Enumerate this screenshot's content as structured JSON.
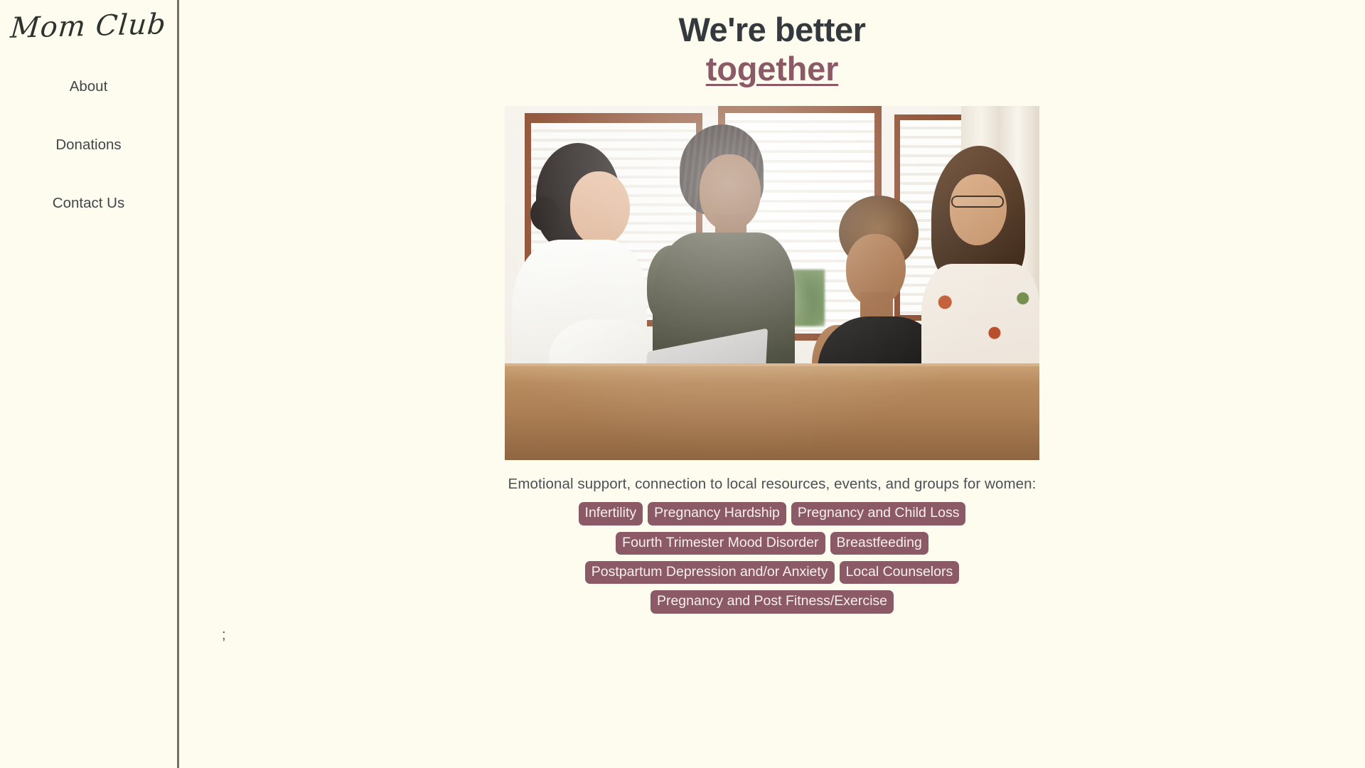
{
  "sidebar": {
    "logo": "Mom Club",
    "items": [
      {
        "label": "About"
      },
      {
        "label": "Donations"
      },
      {
        "label": "Contact Us"
      }
    ]
  },
  "main": {
    "heading_line1": "We're better",
    "heading_line2": "together",
    "photo_alt": "group-of-women-around-table-photo",
    "support_description": "Emotional support, connection to local resources, events, and groups for women:",
    "tag_rows": [
      [
        "Infertility",
        "Pregnancy Hardship",
        "Pregnancy and Child Loss"
      ],
      [
        "Fourth Trimester Mood Disorder",
        "Breastfeeding"
      ],
      [
        "Postpartum Depression and/or Anxiety",
        "Local Counselors"
      ],
      [
        "Pregnancy and Post Fitness/Exercise"
      ]
    ],
    "stray_text": ";"
  },
  "colors": {
    "page_background": "#fdfcef",
    "sidebar_divider": "#6e7364",
    "heading_dark": "#33393d",
    "accent_mauve": "#8b5a66",
    "body_text": "#4b5155"
  }
}
